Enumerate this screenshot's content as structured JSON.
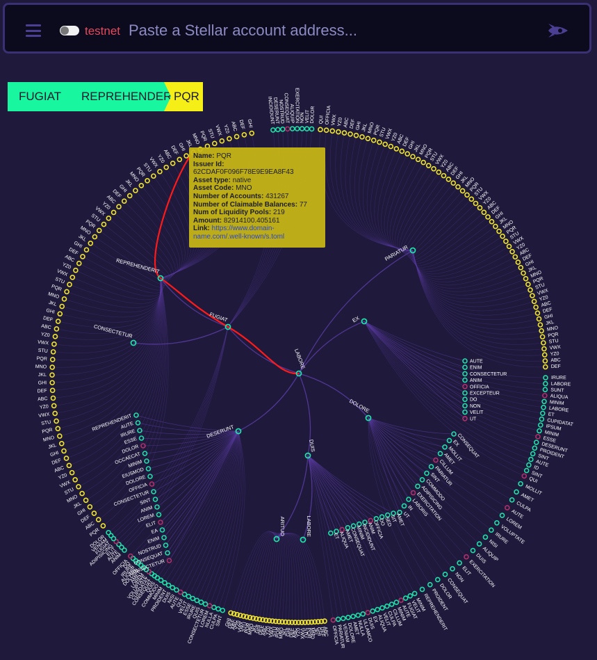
{
  "header": {
    "menu_icon": "hamburger-menu-icon",
    "network_label": "testnet",
    "network_toggle_on": false,
    "search_placeholder": "Paste a Stellar account address...",
    "logo_icon": "rocket-icon"
  },
  "breadcrumb": [
    "FUGIAT",
    "REPREHENDERIT",
    "PQR"
  ],
  "tooltip": {
    "name_label": "Name:",
    "name": "PQR",
    "issuer_label": "Issuer Id:",
    "issuer": "62CDAF0F096F78E9E9EA8F43",
    "asset_type_label": "Asset type:",
    "asset_type": "native",
    "asset_code_label": "Asset Code:",
    "asset_code": "MNO",
    "accounts_label": "Number of Accounts:",
    "accounts": "431267",
    "claimable_label": "Number of Claimable Balances:",
    "claimable": "77",
    "pools_label": "Num of Liquidity Pools:",
    "pools": "219",
    "amount_label": "Amount:",
    "amount": "82914100.405161",
    "link_label": "Link:",
    "link": "https://www.domain-name.com/.well-known/s.toml"
  },
  "colors": {
    "background": "#1f1a3c",
    "edge": "#5b3ca3",
    "highlight_path": "#ff1a1a",
    "node_teal": "#1fe0a8",
    "node_yellow": "#f2e62a",
    "node_magenta": "#b0306a",
    "crumb_green": "#18f7a0",
    "crumb_yellow": "#f6ee17"
  },
  "graph": {
    "root": "LABORE",
    "highlight_path": [
      "LABORE",
      "FUGIAT",
      "REPREHENDERIT",
      "PQR"
    ],
    "inner_nodes": [
      {
        "name": "LABORE",
        "root": true
      },
      {
        "name": "FUGIAT"
      },
      {
        "name": "REPREHENDERIT"
      },
      {
        "name": "CONSECTETUR"
      },
      {
        "name": "PARIATUR"
      },
      {
        "name": "EX"
      },
      {
        "name": "DOLORE"
      },
      {
        "name": "DUIS"
      },
      {
        "name": "DESERUNT"
      },
      {
        "name": "ARITUO"
      },
      {
        "name": "LABORE"
      }
    ],
    "leaf_groups": [
      {
        "color": "yellow",
        "names": [
          "PQR",
          "ABC",
          "DEF",
          "GHI",
          "JKL",
          "MNO",
          "STU",
          "VWX",
          "YZ0",
          "ABC",
          "DEF",
          "GHI",
          "JKL",
          "MNO",
          "PQR",
          "STU",
          "VWX",
          "YZ0",
          "ABC",
          "DEF",
          "GHI",
          "JKL",
          "MNO",
          "PQR",
          "STU",
          "VWX",
          "YZ0",
          "ABC",
          "DEF",
          "GHI",
          "JKL",
          "MNO",
          "PQR",
          "STU",
          "VWX",
          "YZ0",
          "ABC",
          "DEF",
          "GHI",
          "JKL",
          "MNO",
          "PQR",
          "STU",
          "VWX",
          "YZ0",
          "ABC",
          "DEF",
          "GHI",
          "JKL",
          "MNO",
          "PQR",
          "STU",
          "VWX",
          "YZ0",
          "ABC",
          "DEF",
          "GHI",
          "JKL",
          "MNO",
          "PQR",
          "STU",
          "VWX",
          "YZ0",
          "ABC",
          "DEF",
          "GHI"
        ]
      },
      {
        "color": "teal",
        "names": [
          "ANIM",
          "AUTE",
          "ELIT",
          "ADIPISICING",
          "FUGIAT",
          "VENIAM",
          "DOLOR"
        ]
      },
      {
        "color": "teal",
        "names": [
          "INCIDIDUNT",
          "DESERUNT",
          "NOSTRUD",
          "CONSEQUAT",
          "ALIQUIP",
          "EXERCITATION",
          "NON",
          "VELIT",
          "DOLOR"
        ]
      },
      {
        "color": "yellow",
        "names": [
          "QUI",
          "OFFICIA",
          "VWX",
          "YZ0",
          "ABC",
          "DEF",
          "GHI",
          "JKL",
          "MNO",
          "PQR",
          "STU",
          "VWX",
          "YZ0",
          "ABC",
          "DEF",
          "GHI",
          "JKL",
          "MNO",
          "PQR",
          "STU",
          "VWX",
          "YZ0",
          "ABC",
          "DEF",
          "GHI",
          "JKL",
          "MNO",
          "PQR",
          "STU",
          "VWX",
          "YZ0",
          "ABC",
          "DEF",
          "GHI",
          "JKL",
          "MNO",
          "PQR",
          "STU",
          "VWX",
          "YZ0",
          "ABC",
          "DEF",
          "GHI",
          "JKL",
          "MNO",
          "PQR",
          "STU",
          "VWX",
          "YZ0",
          "ABC",
          "DEF",
          "GHI",
          "JKL",
          "MNO",
          "PQR",
          "STU",
          "VWX",
          "YZ0",
          "ABC",
          "DEF"
        ]
      },
      {
        "color": "teal",
        "names": [
          "IRURE",
          "LABORE",
          "SUNT",
          "ALIQUA",
          "MINIM",
          "LABORE",
          "ET",
          "CUPIDATAT",
          "IPSUM",
          "MINIM",
          "ESSE",
          "DESERUNT",
          "PROIDENT",
          "SINT",
          "AUTE",
          "ID",
          "SINT",
          "QUI"
        ]
      },
      {
        "color": "teal",
        "names": [
          "MOLLIT",
          "AMET",
          "CULPA",
          "AUTE",
          "LOREM",
          "VOLUPTATE",
          "IRURE",
          "NISI",
          "ALIQUIP",
          "DUIS",
          "EXERCITATION",
          "ELIT",
          "NON",
          "CONSEQUAT",
          "DOLOR",
          "PROIDENT",
          "REPREHENDERIT"
        ]
      },
      {
        "color": "teal",
        "names": [
          "MINIM",
          "VELIT",
          "FUGIAT",
          "AUTE",
          "MINIM",
          "CILLUM",
          "CULPA",
          "VELIT",
          "ALIQUA",
          "EX",
          "DUIS",
          "ULLAMCO",
          "NULLA",
          "AMET",
          "DOLORE",
          "VENIAM",
          "PARIATUR",
          "OFFICIA"
        ]
      },
      {
        "color": "yellow",
        "names": [
          "ABC",
          "DEF",
          "GHI",
          "JKL",
          "MNO",
          "PQR",
          "STU",
          "VWX",
          "YZ0",
          "ABC",
          "DEF",
          "GHI",
          "JKL",
          "MNO",
          "PQR",
          "STU",
          "VWX",
          "YZ0",
          "ABC",
          "DEF",
          "GHI",
          "JKL",
          "MNO",
          "PQR",
          "STU",
          "VWX",
          "YZ0",
          "ABC",
          "DEF",
          "GHI"
        ]
      },
      {
        "color": "teal",
        "names": [
          "SINT",
          "CULPA",
          "NULLA",
          "LOREM",
          "CONSECTETUR",
          "QUIS",
          "IRURE",
          "ESSE",
          "VELIT",
          "QUI",
          "AUTE",
          "NISI",
          "DUIS",
          "PROIDENT",
          "MINIM",
          "COMMODO"
        ]
      },
      {
        "color": "teal",
        "names": [
          "QUIS",
          "CONSEQUAT",
          "CUPIDATAT",
          "VOLUPTATE",
          "LOREM",
          "AMET",
          "DOLORE",
          "ALIQUIP",
          "IRURE",
          "DO",
          "OFFICIA"
        ]
      }
    ],
    "inner_leaves": [
      {
        "group": "ex",
        "names": [
          "AUTE",
          "ENIM",
          "CONSECTETUR",
          "ANIM",
          "OFFICIA",
          "EXCEPTEUR",
          "DO",
          "NON",
          "VELIT",
          "UT"
        ]
      },
      {
        "group": "dolore",
        "names": [
          "CONSEQUAT",
          "EX",
          "MOLLIT",
          "AMET",
          "CILLUM",
          "PARIATUR",
          "SINT",
          "COMMODO",
          "ADIPISICING",
          "EXERCITATION",
          "LABORIS",
          "IN",
          "UT"
        ]
      },
      {
        "group": "duis",
        "names": [
          "AMET",
          "SIT",
          "SED",
          "DO",
          "OFFICIA",
          "ANIM",
          "INCIDIDUNT",
          "MINIM",
          "CONSEQUAT",
          "AMET",
          "ALIQUA",
          "ET"
        ]
      },
      {
        "group": "deserunt",
        "names": [
          "REPREHENDERIT",
          "AUTE",
          "IRURE",
          "ESSE",
          "DOLOR",
          "OCCAECAT",
          "MINIM",
          "EIUSMOD",
          "DOLORE",
          "OFFICIA",
          "CONSECTETUR",
          "SINT",
          "ANIM",
          "LOREM",
          "ELIT",
          "EA",
          "ENIM",
          "NOSTRUD",
          "CONSEQUAT",
          "CONSECTETUR"
        ]
      }
    ]
  }
}
